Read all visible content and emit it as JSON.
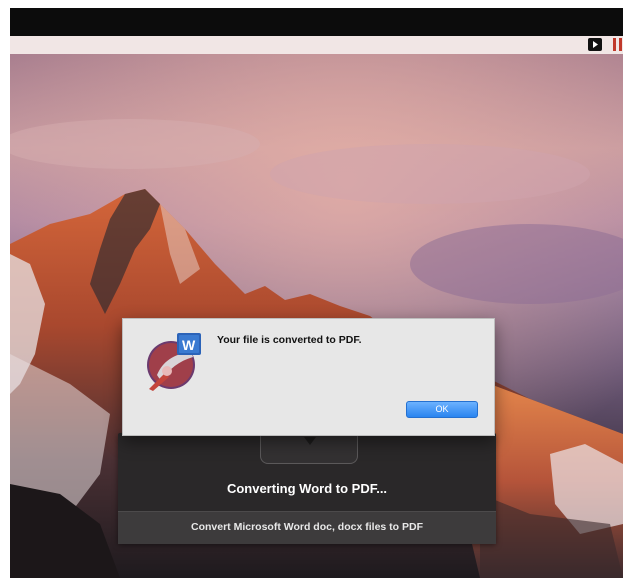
{
  "alert": {
    "message": "Your file is converted to PDF.",
    "ok_label": "OK"
  },
  "converter": {
    "status": "Converting Word to PDF...",
    "footer": "Convert Microsoft Word doc, docx files to PDF"
  },
  "icons": {
    "app": "word-to-pdf-app-icon",
    "drop_well": "chevron-down-icon",
    "play": "play-icon",
    "pause": "pause-icon"
  },
  "colors": {
    "ok_button": "#2a84f0",
    "panel_dark": "#2a2829",
    "alert_bg": "#e7e7e7",
    "pause_red": "#c0392b"
  }
}
